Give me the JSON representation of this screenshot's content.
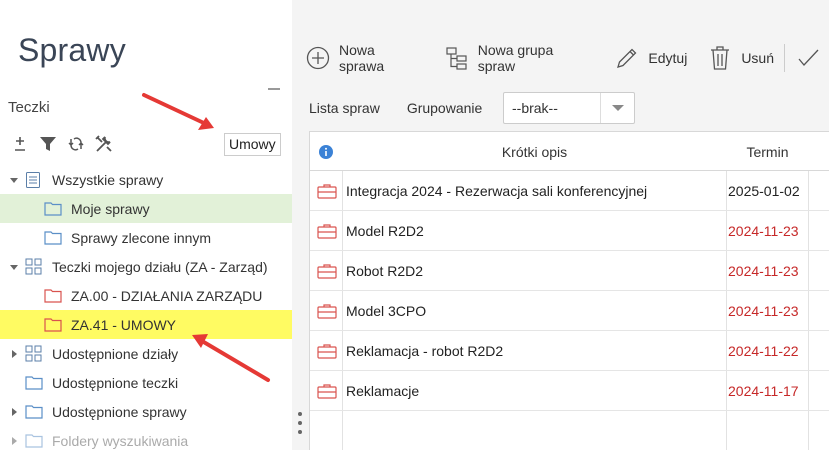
{
  "app": {
    "title": "Sprawy"
  },
  "left_panel": {
    "title": "Teczki",
    "filter_value": "Umowy",
    "tools": [
      "add-icon",
      "filter-icon",
      "refresh-icon",
      "settings-tools-icon"
    ],
    "tree": [
      {
        "label": "Wszystkie sprawy",
        "icon": "all-cases-icon",
        "level": 0,
        "expanded": true
      },
      {
        "label": "Moje sprawy",
        "icon": "folder-icon",
        "level": 1,
        "state": "selected"
      },
      {
        "label": "Sprawy zlecone innym",
        "icon": "folder-icon",
        "level": 1
      },
      {
        "label": "Teczki mojego działu (ZA - Zarząd)",
        "icon": "department-icon",
        "level": 0,
        "expanded": true
      },
      {
        "label": "ZA.00 - DZIAŁANIA ZARZĄDU",
        "icon": "folder-red-icon",
        "level": 1
      },
      {
        "label": "ZA.41 - UMOWY",
        "icon": "folder-red-icon",
        "level": 1,
        "state": "highlighted"
      },
      {
        "label": "Udostępnione działy",
        "icon": "department-icon",
        "level": 0,
        "expanded": false
      },
      {
        "label": "Udostępnione teczki",
        "icon": "folder-icon",
        "level": 0
      },
      {
        "label": "Udostępnione sprawy",
        "icon": "folder-icon",
        "level": 0,
        "expanded": false
      },
      {
        "label": "Foldery wyszukiwania",
        "icon": "folder-icon",
        "level": 0,
        "expanded": false,
        "disabled": true
      }
    ]
  },
  "toolbar": {
    "new_case": "Nowa sprawa",
    "new_group": "Nowa grupa spraw",
    "edit": "Edytuj",
    "delete": "Usuń"
  },
  "list": {
    "title": "Lista spraw",
    "grouping_label": "Grupowanie",
    "grouping_value": "--brak--",
    "columns": {
      "info": "info-icon",
      "description": "Krótki opis",
      "deadline": "Termin"
    },
    "rows": [
      {
        "description": "Integracja 2024 - Rezerwacja sali konferencyjnej",
        "deadline": "2025-01-02",
        "overdue": false
      },
      {
        "description": "Model R2D2",
        "deadline": "2024-11-23",
        "overdue": true
      },
      {
        "description": "Robot R2D2",
        "deadline": "2024-11-23",
        "overdue": true
      },
      {
        "description": "Model 3CPO",
        "deadline": "2024-11-23",
        "overdue": true
      },
      {
        "description": "Reklamacja - robot R2D2",
        "deadline": "2024-11-22",
        "overdue": true
      },
      {
        "description": "Reklamacje",
        "deadline": "2024-11-17",
        "overdue": true
      }
    ]
  },
  "colors": {
    "selected_bg": "#e2f1d8",
    "highlight_bg": "#fffb62",
    "overdue": "#c62828",
    "annotation_arrow": "#e53935",
    "info_icon": "#3b82d6"
  }
}
